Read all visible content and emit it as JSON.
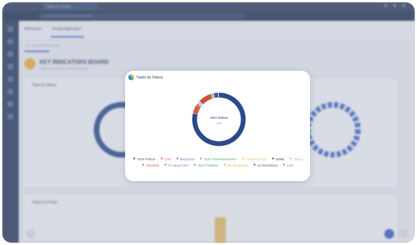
{
  "browser": {
    "tab_title": "Tasks by Status",
    "url": "ms-portal.app/dashboard/key-indicators"
  },
  "app": {
    "workspace_label": "Workspace",
    "project_label": "Granite Application",
    "breadcrumb": "KEY INDICATORS BOARD",
    "board_title": "KEY INDICATORS BOARD",
    "board_subtitle": "Project task status & workflow summary"
  },
  "background_cards": {
    "tasks_by_status_title": "Tasks by Status",
    "tasks_by_priority_title": "Tasks by Priority"
  },
  "modal": {
    "title": "Tasks by Status",
    "center_label": "TEST PARIJA",
    "center_value": "175"
  },
  "chart_data": {
    "type": "pie",
    "title": "Tasks by Status",
    "categories": [
      "TEST PARIJA",
      "LIVE",
      "BACKLOG",
      "TEST PARAMESHWARY",
      "PD-SELECTED",
      "DONE",
      "IDEAS",
      "ARCHIVE",
      "PY-SELECTED",
      "TEST THOMAS",
      "PD-SELECTED",
      "IN PROGRESS",
      "LIVE"
    ],
    "values": [
      175,
      12,
      2,
      1,
      1,
      1,
      1,
      18,
      1,
      2,
      1,
      6,
      1
    ],
    "colors": [
      "#2b4a8c",
      "#e05a3c",
      "#7a5fa8",
      "#47a96b",
      "#f0b96a",
      "#2b3c5e",
      "#8fb7e8",
      "#d04d3a",
      "#6f7fd0",
      "#3f9b5a",
      "#e8a94d",
      "#4b4f9a",
      "#3d8bdc"
    ],
    "legend_position": "bottom"
  },
  "legend_rows": [
    [
      {
        "label": "TEST PARIJA",
        "color": "#2b4a8c"
      },
      {
        "label": "LIVE",
        "color": "#e05a3c"
      },
      {
        "label": "BACKLOG",
        "color": "#7a5fa8"
      },
      {
        "label": "TEST PARAMESHWARY",
        "color": "#47a96b"
      },
      {
        "label": "PD-SELECTED",
        "color": "#f0b96a"
      },
      {
        "label": "DONE",
        "color": "#2b3c5e"
      },
      {
        "label": "IDEAS",
        "color": "#8fb7e8"
      }
    ],
    [
      {
        "label": "ARCHIVE",
        "color": "#d04d3a"
      },
      {
        "label": "PY-SELECTED",
        "color": "#6f7fd0"
      },
      {
        "label": "TEST THOMAS",
        "color": "#3f9b5a"
      },
      {
        "label": "PD-SELECTED",
        "color": "#e8a94d"
      },
      {
        "label": "IN PROGRESS",
        "color": "#4b4f9a"
      },
      {
        "label": "LIVE",
        "color": "#3d8bdc"
      }
    ]
  ]
}
